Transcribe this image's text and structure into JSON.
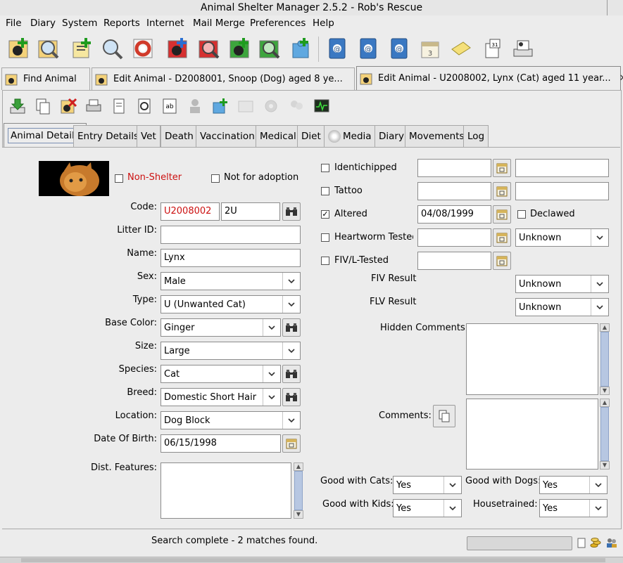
{
  "window": {
    "title": "Animal Shelter Manager 2.5.2 - Rob's Rescue"
  },
  "menu": [
    "File",
    "Diary",
    "System",
    "Reports",
    "Internet",
    "Mail Merge",
    "Preferences",
    "Help"
  ],
  "doc_tabs": {
    "find": "Find Animal",
    "edit1": "Edit Animal - D2008001, Snoop (Dog) aged 8 ye...",
    "edit2": "Edit Animal - U2008002, Lynx (Cat) aged 11 year...",
    "close": "✕"
  },
  "sub_tabs": [
    "Animal Details",
    "Entry Details",
    "Vet",
    "Death",
    "Vaccination",
    "Medical",
    "Diet",
    "Media",
    "Diary",
    "Movements",
    "Log"
  ],
  "form": {
    "non_shelter": "Non-Shelter",
    "not_for_adoption": "Not for adoption",
    "code_label": "Code:",
    "code_value": "U2008002",
    "short_code_value": "2U",
    "litter_label": "Litter ID:",
    "litter_value": "",
    "name_label": "Name:",
    "name_value": "Lynx",
    "sex_label": "Sex:",
    "sex_value": "Male",
    "type_label": "Type:",
    "type_value": "U (Unwanted Cat)",
    "base_color_label": "Base Color:",
    "base_color_value": "Ginger",
    "size_label": "Size:",
    "size_value": "Large",
    "species_label": "Species:",
    "species_value": "Cat",
    "breed_label": "Breed:",
    "breed_value": "Domestic Short Hair",
    "location_label": "Location:",
    "location_value": "Dog Block",
    "dob_label": "Date Of Birth:",
    "dob_value": "06/15/1998",
    "dist_label": "Dist. Features:",
    "identichipped_label": "Identichipped",
    "tattoo_label": "Tattoo",
    "altered_label": "Altered",
    "altered_date": "04/08/1999",
    "declawed_label": "Declawed",
    "heartworm_label": "Heartworm Tested",
    "heartworm_result": "Unknown",
    "fivl_label": "FIV/L-Tested",
    "fiv_result_label": "FIV Result",
    "fiv_result": "Unknown",
    "flv_result_label": "FLV Result",
    "flv_result": "Unknown",
    "hidden_comments_label": "Hidden Comments:",
    "comments_label": "Comments:",
    "good_cats_label": "Good with Cats:",
    "good_cats_value": "Yes",
    "good_dogs_label": "Good with Dogs:",
    "good_dogs_value": "Yes",
    "good_kids_label": "Good with Kids:",
    "good_kids_value": "Yes",
    "housetrained_label": "Housetrained:",
    "housetrained_value": "Yes"
  },
  "status": {
    "text": "Search complete - 2 matches found."
  },
  "colors": {
    "accent_red": "#cc1111",
    "selected_tab_border": "#7a8fb3"
  }
}
